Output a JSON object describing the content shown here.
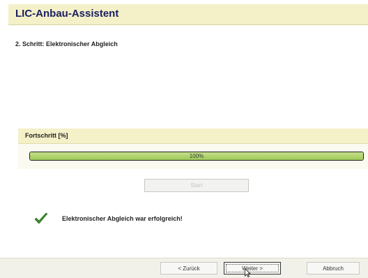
{
  "window": {
    "title": "LIC-Anbau-Assistent"
  },
  "step": {
    "label": "2. Schritt: Elektronischer Abgleich"
  },
  "progress": {
    "section_label": "Fortschritt [%]",
    "value_percent": 100,
    "text": "100%",
    "fill_color": "#a8d060"
  },
  "start_button": {
    "label": "Start",
    "enabled": false
  },
  "result": {
    "icon": "checkmark-icon",
    "message": "Elektronischer Abgleich war erfolgreich!",
    "icon_color": "#3a8a2a"
  },
  "footer": {
    "back_label": "< Zurück",
    "next_label": "Weiter >",
    "cancel_label": "Abbruch"
  },
  "colors": {
    "header_bg": "#f4f0c8",
    "title_color": "#1a2060"
  }
}
